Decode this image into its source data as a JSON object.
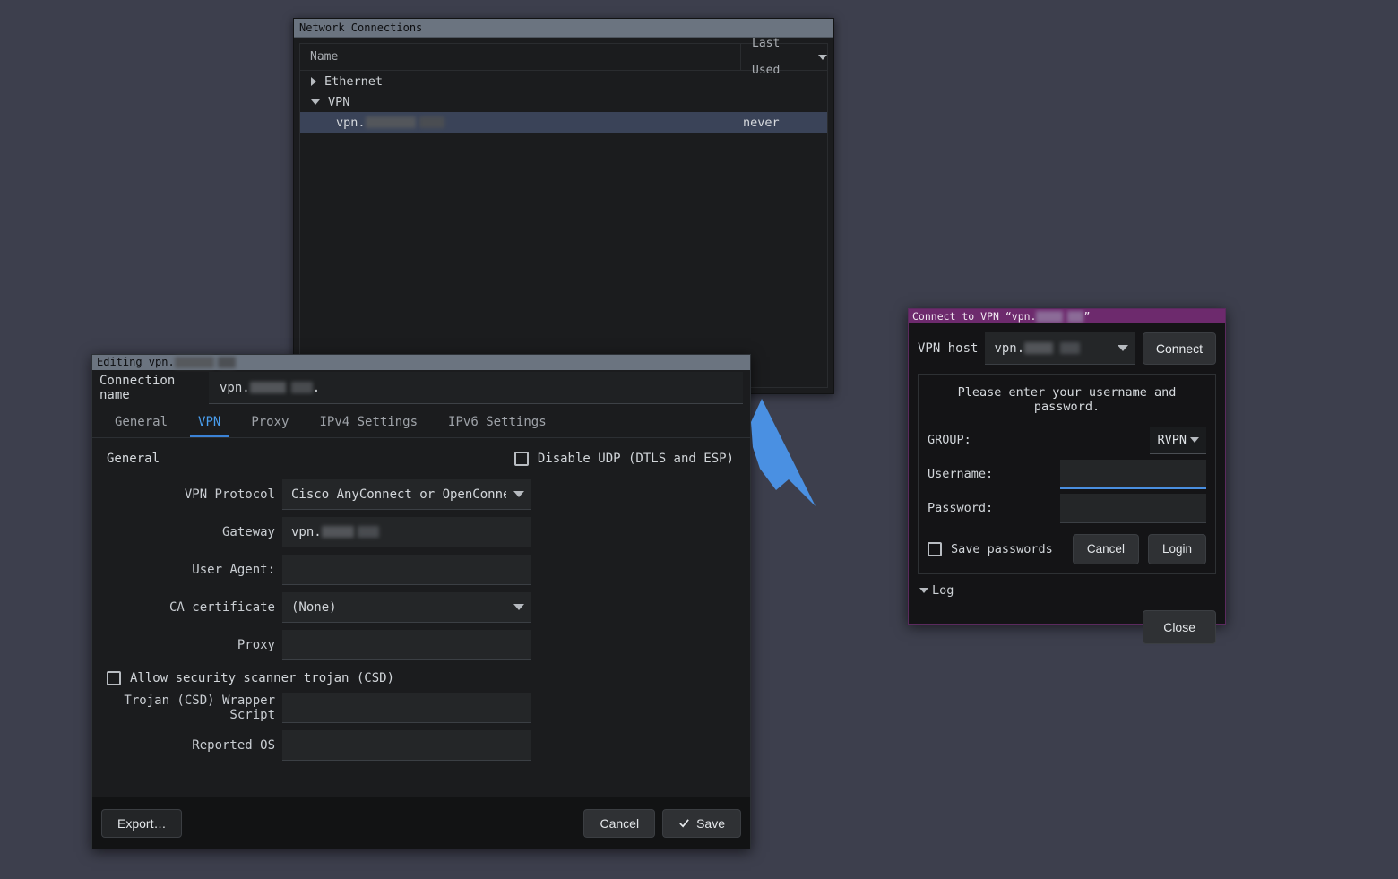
{
  "desktop": {
    "background": "#3d3f4d"
  },
  "network_connections": {
    "title": "Network Connections",
    "columns": {
      "name": "Name",
      "last_used": "Last Used"
    },
    "groups": [
      {
        "label": "Ethernet",
        "expanded": false,
        "icon": "chevron-right-icon",
        "children": []
      },
      {
        "label": "VPN",
        "expanded": true,
        "icon": "chevron-down-icon",
        "children": [
          {
            "name": "vpn.",
            "name_redacted": true,
            "last_used": "never",
            "selected": true
          }
        ]
      }
    ]
  },
  "editing_dialog": {
    "title": "Editing vpn.",
    "connection_name_label": "Connection name",
    "connection_name_value": "vpn.",
    "tabs": [
      {
        "label": "General",
        "active": false
      },
      {
        "label": "VPN",
        "active": true
      },
      {
        "label": "Proxy",
        "active": false
      },
      {
        "label": "IPv4 Settings",
        "active": false
      },
      {
        "label": "IPv6 Settings",
        "active": false
      }
    ],
    "section_header": "General",
    "disable_udp": {
      "label": "Disable UDP (DTLS and ESP)",
      "checked": false
    },
    "fields": [
      {
        "label": "VPN Protocol",
        "value": "Cisco AnyConnect or OpenConnect",
        "type": "select"
      },
      {
        "label": "Gateway",
        "value": "vpn.",
        "type": "text",
        "redacted": true
      },
      {
        "label": "User Agent:",
        "value": "",
        "type": "text"
      },
      {
        "label": "CA certificate",
        "value": "(None)",
        "type": "select"
      },
      {
        "label": "Proxy",
        "value": "",
        "type": "text"
      }
    ],
    "allow_csd": {
      "label": "Allow security scanner trojan (CSD)",
      "checked": false
    },
    "fields2": [
      {
        "label": "Trojan (CSD) Wrapper Script",
        "value": "",
        "type": "text"
      },
      {
        "label": "Reported OS",
        "value": "",
        "type": "text"
      }
    ],
    "buttons": {
      "export": "Export…",
      "cancel": "Cancel",
      "save": "Save",
      "save_icon": "check-icon"
    }
  },
  "vpn_connect_dialog": {
    "title": "Connect to VPN “vpn.",
    "title_suffix": "”",
    "host_label": "VPN host",
    "host_value": "vpn.",
    "connect_button": "Connect",
    "prompt": "Please enter your username and password.",
    "group_label": "GROUP:",
    "group_value": "RVPN",
    "username_label": "Username:",
    "username_value": "",
    "password_label": "Password:",
    "password_value": "",
    "save_passwords": {
      "label": "Save passwords",
      "checked": false
    },
    "cancel_button": "Cancel",
    "login_button": "Login",
    "log_label": "Log",
    "log_expanded": true,
    "close_button": "Close",
    "accent_title_bar": "#6d2a6d",
    "focus_color": "#4a8fe0"
  },
  "cursor": {
    "icon": "arrow-pointer-icon",
    "color": "#4a90e2"
  }
}
